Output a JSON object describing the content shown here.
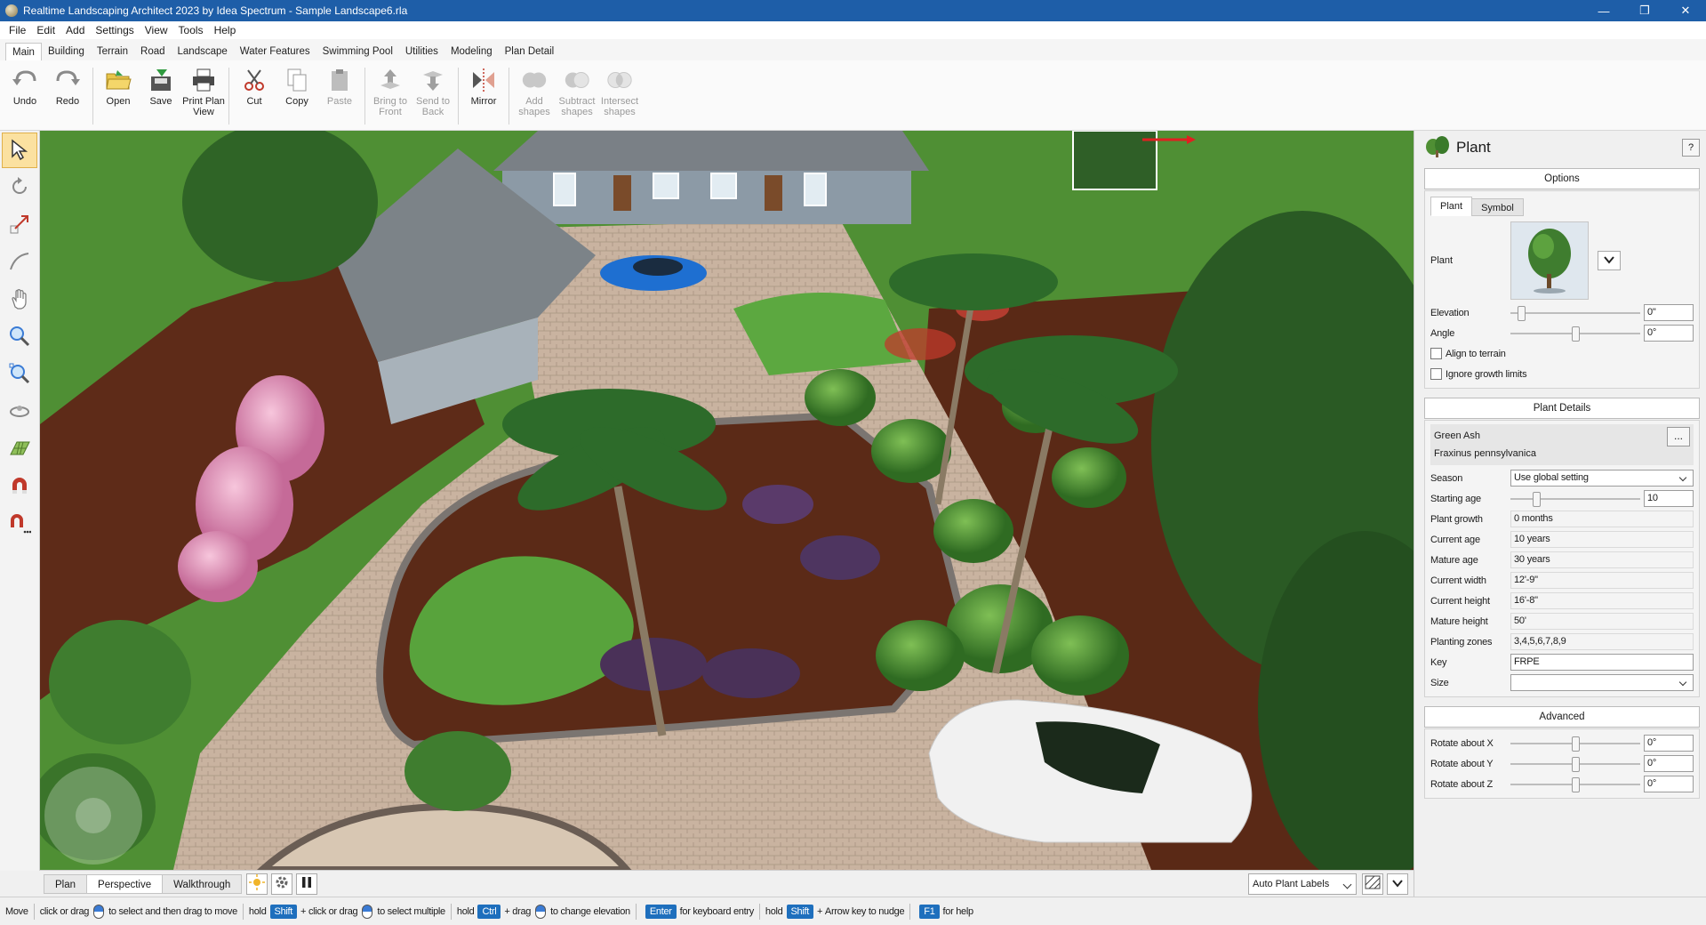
{
  "window": {
    "title": "Realtime Landscaping Architect 2023 by Idea Spectrum - Sample Landscape6.rla",
    "minimize": "—",
    "restore": "❐",
    "close": "✕"
  },
  "menu": [
    "File",
    "Edit",
    "Add",
    "Settings",
    "View",
    "Tools",
    "Help"
  ],
  "ribbon_tabs": [
    "Main",
    "Building",
    "Terrain",
    "Road",
    "Landscape",
    "Water Features",
    "Swimming Pool",
    "Utilities",
    "Modeling",
    "Plan Detail"
  ],
  "toolbar": {
    "undo": "Undo",
    "redo": "Redo",
    "open": "Open",
    "save": "Save",
    "print_plan_view": "Print Plan View",
    "cut": "Cut",
    "copy": "Copy",
    "paste": "Paste",
    "bring_to_front": "Bring to Front",
    "send_to_back": "Send to Back",
    "mirror": "Mirror",
    "add_shapes": "Add shapes",
    "subtract_shapes": "Subtract shapes",
    "intersect_shapes": "Intersect shapes"
  },
  "view_tabs": [
    "Plan",
    "Perspective",
    "Walkthrough"
  ],
  "view_labels_dropdown": "Auto Plant Labels",
  "panel": {
    "title": "Plant",
    "help": "?",
    "options_header": "Options",
    "subtabs": [
      "Plant",
      "Symbol"
    ],
    "plant_label": "Plant",
    "elevation_label": "Elevation",
    "elevation_value": "0\"",
    "elevation_slider": 0.08,
    "angle_label": "Angle",
    "angle_value": "0°",
    "angle_slider": 0.5,
    "align_to_terrain": "Align to terrain",
    "ignore_growth_limits": "Ignore growth limits",
    "details_header": "Plant Details",
    "common_name": "Green Ash",
    "botanical_name": "Fraxinus pennsylvanica",
    "browse_button": "...",
    "season_label": "Season",
    "season_value": "Use global setting",
    "starting_age_label": "Starting age",
    "starting_age_value": "10",
    "starting_age_slider": 0.2,
    "plant_growth_label": "Plant growth",
    "plant_growth_value": "0 months",
    "current_age_label": "Current age",
    "current_age_value": "10 years",
    "mature_age_label": "Mature age",
    "mature_age_value": "30 years",
    "current_width_label": "Current width",
    "current_width_value": "12'-9\"",
    "current_height_label": "Current height",
    "current_height_value": "16'-8\"",
    "mature_height_label": "Mature height",
    "mature_height_value": "50'",
    "planting_zones_label": "Planting zones",
    "planting_zones_value": "3,4,5,6,7,8,9",
    "key_label": "Key",
    "key_value": "FRPE",
    "size_label": "Size",
    "size_value": "",
    "advanced_header": "Advanced",
    "rotate_x_label": "Rotate about X",
    "rotate_x_value": "0°",
    "rotate_y_label": "Rotate about Y",
    "rotate_y_value": "0°",
    "rotate_z_label": "Rotate about Z",
    "rotate_z_value": "0°",
    "rotate_slider": 0.5
  },
  "status": {
    "mode": "Move",
    "s1": "click or drag",
    "s2": "to select and then drag to move",
    "hold1": "hold",
    "shift": "Shift",
    "s3": "click or drag",
    "s4": "to select multiple",
    "hold2": "hold",
    "ctrl": "Ctrl",
    "s5": "drag",
    "s6": "to change elevation",
    "enter": "Enter",
    "s7": "for keyboard entry",
    "hold3": "hold",
    "shift2": "Shift",
    "s8": "Arrow key to nudge",
    "f1": "F1",
    "s9": "for help"
  }
}
